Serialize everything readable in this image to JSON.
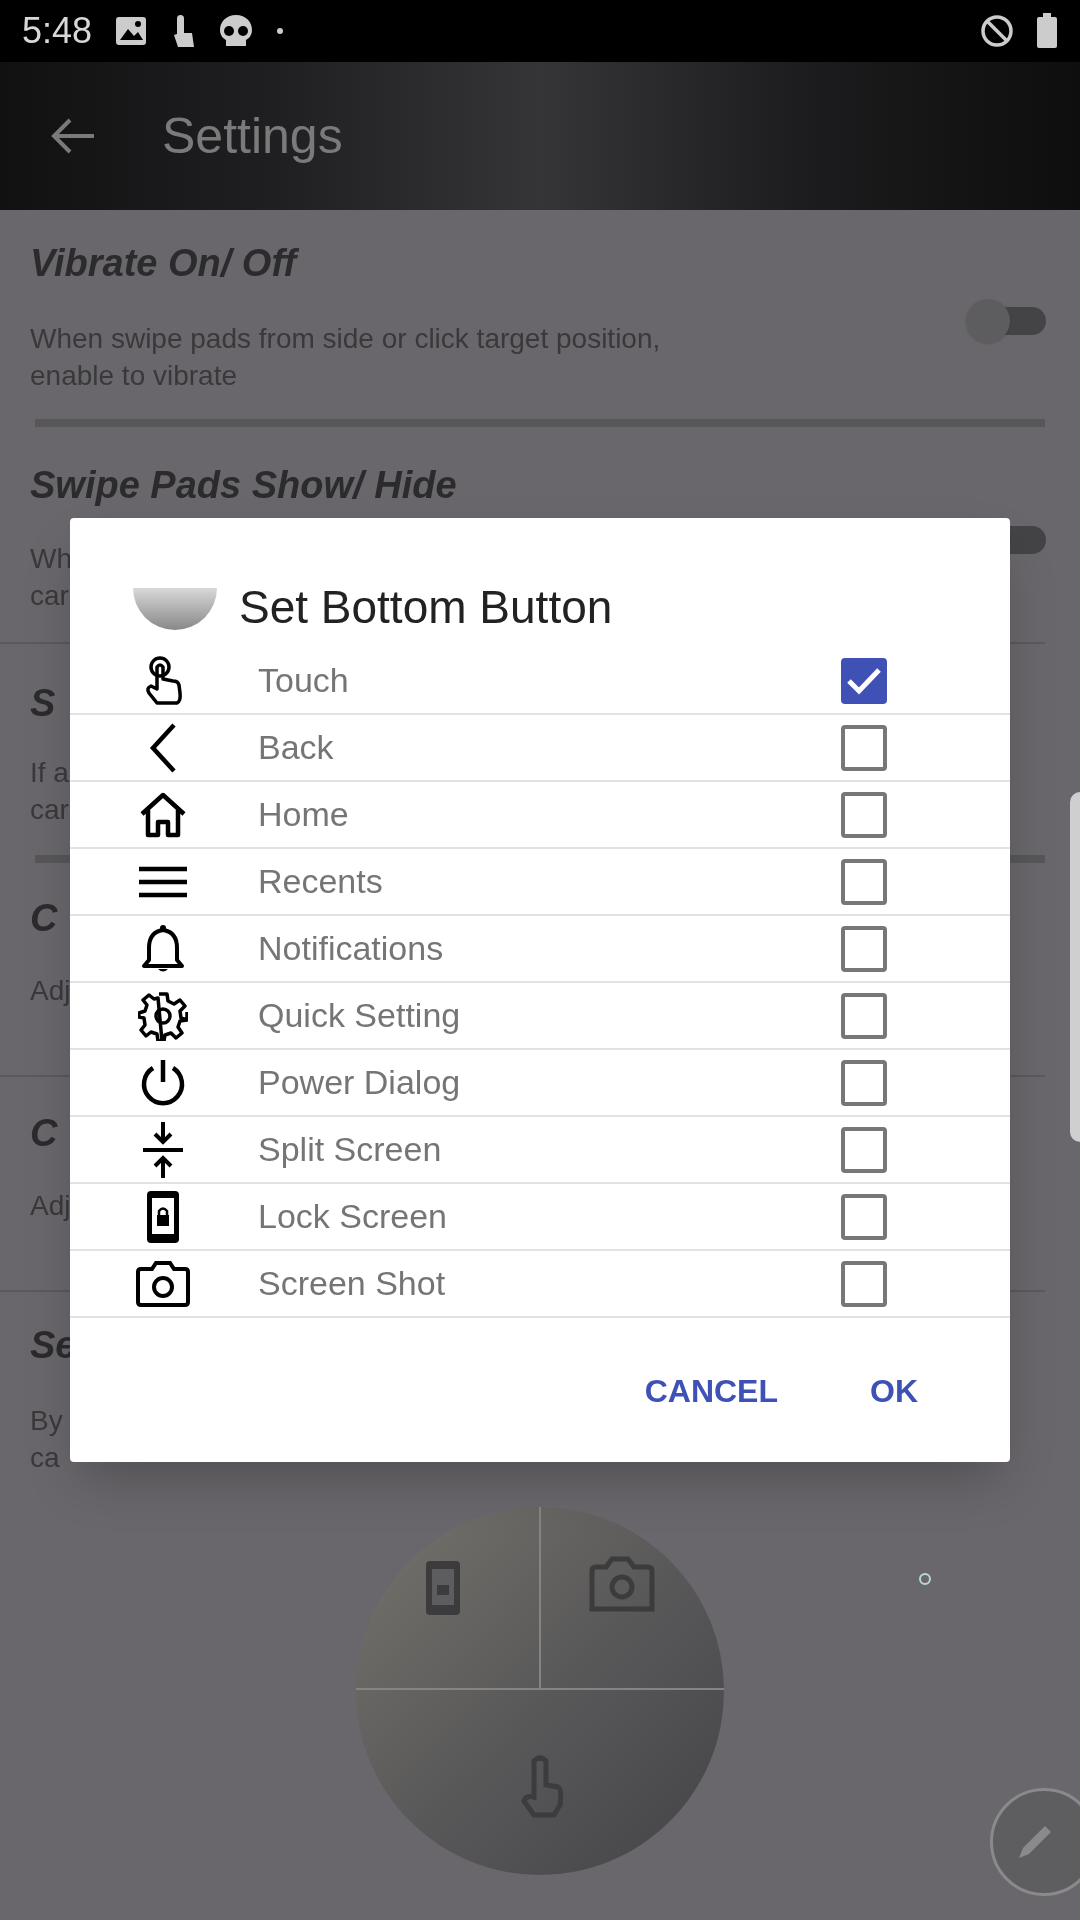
{
  "status_bar": {
    "time": "5:48"
  },
  "app_bar": {
    "title": "Settings"
  },
  "settings": [
    {
      "title": "Vibrate On/ Off",
      "lines": [
        "When swipe pads from side or click target position,",
        "enable to vibrate"
      ],
      "toggle": {
        "on": false
      }
    },
    {
      "title": "Swipe Pads Show/ Hide",
      "lines": [
        "Wh",
        "car"
      ],
      "toggle": {
        "on": false
      }
    },
    {
      "title": "S",
      "lines": [
        "If a",
        "car"
      ]
    },
    {
      "title": "C",
      "lines": [
        "Adj"
      ]
    },
    {
      "title": "C",
      "lines": [
        "Adj"
      ]
    },
    {
      "title": "Se",
      "lines": [
        "By",
        "ca"
      ]
    }
  ],
  "dialog": {
    "title": "Set Bottom Button",
    "options": [
      {
        "label": "Touch",
        "checked": true
      },
      {
        "label": "Back",
        "checked": false
      },
      {
        "label": "Home",
        "checked": false
      },
      {
        "label": "Recents",
        "checked": false
      },
      {
        "label": "Notifications",
        "checked": false
      },
      {
        "label": "Quick Setting",
        "checked": false
      },
      {
        "label": "Power Dialog",
        "checked": false
      },
      {
        "label": "Split Screen",
        "checked": false
      },
      {
        "label": "Lock Screen",
        "checked": false
      },
      {
        "label": "Screen Shot",
        "checked": false
      }
    ],
    "buttons": [
      "CANCEL",
      "OK"
    ]
  }
}
